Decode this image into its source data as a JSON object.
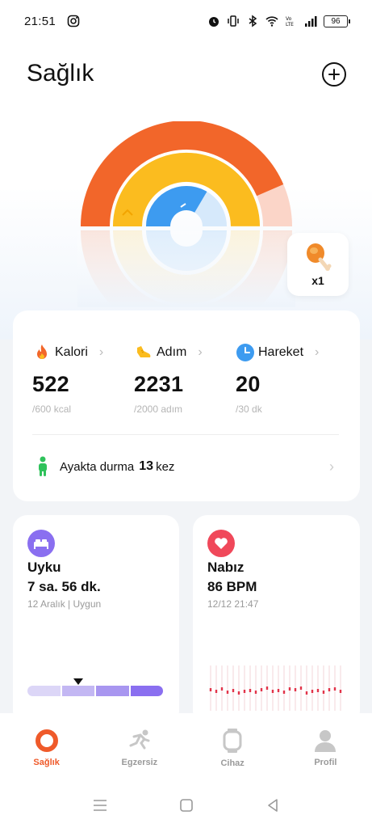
{
  "status_bar": {
    "time": "21:51",
    "battery": "96"
  },
  "header": {
    "title": "Sağlık"
  },
  "food": {
    "count": "x1"
  },
  "metrics": [
    {
      "label": "Kalori",
      "value": "522",
      "goal": "/600 kcal",
      "color": "#f2662a",
      "progress": 0.87
    },
    {
      "label": "Adım",
      "value": "2231",
      "goal": "/2000 adım",
      "color": "#fbbc1f",
      "progress": 1.0
    },
    {
      "label": "Hareket",
      "value": "20",
      "goal": "/30 dk",
      "color": "#3d9bf0",
      "progress": 0.67
    }
  ],
  "standing": {
    "prefix": "Ayakta durma",
    "count": "13",
    "suffix": "kez"
  },
  "sleep": {
    "title": "Uyku",
    "value": "7 sa. 56 dk.",
    "sub": "12 Aralık | Uygun",
    "color": "#8a6ff0"
  },
  "pulse": {
    "title": "Nabız",
    "value": "86 BPM",
    "sub": "12/12 21:47",
    "color": "#f0485a"
  },
  "nav": [
    {
      "label": "Sağlık",
      "active": true
    },
    {
      "label": "Egzersiz",
      "active": false
    },
    {
      "label": "Cihaz",
      "active": false
    },
    {
      "label": "Profil",
      "active": false
    }
  ],
  "colors": {
    "accent": "#ef5a2a",
    "calorie": "#f2662a",
    "steps": "#fbbc1f",
    "move": "#3d9bf0"
  }
}
